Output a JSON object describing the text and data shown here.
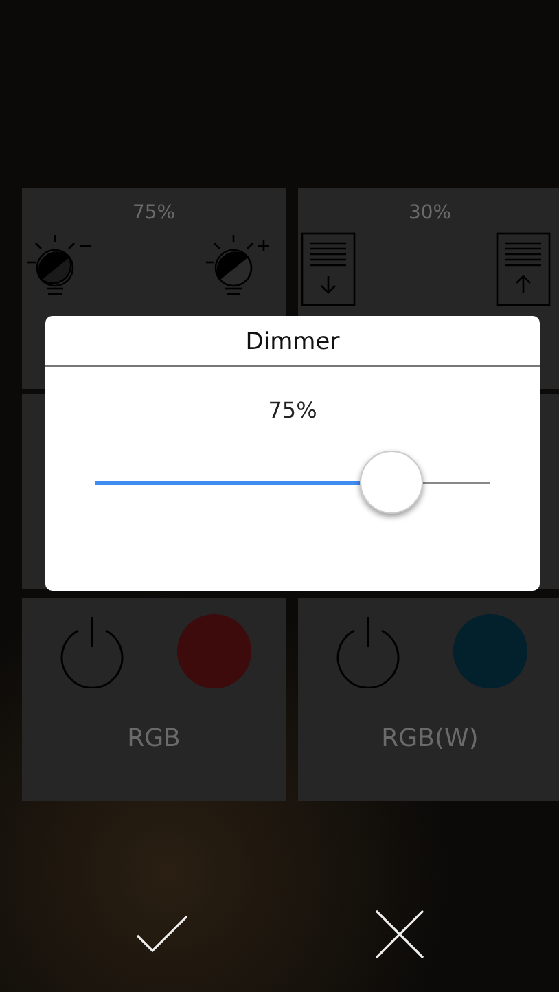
{
  "tiles": [
    {
      "kind": "dimmer",
      "reading": "75%"
    },
    {
      "kind": "blinds",
      "reading": "30%"
    },
    {
      "kind": "hidden"
    },
    {
      "kind": "hidden"
    },
    {
      "kind": "color",
      "label": "RGB",
      "color": "#3d0b0b"
    },
    {
      "kind": "color",
      "label": "RGB(W)",
      "color": "#03202d"
    }
  ],
  "dialog": {
    "title": "Dimmer",
    "reading": "75%",
    "level": 0.75
  },
  "actions": [
    {
      "kind": "confirm"
    },
    {
      "kind": "cancel"
    }
  ]
}
